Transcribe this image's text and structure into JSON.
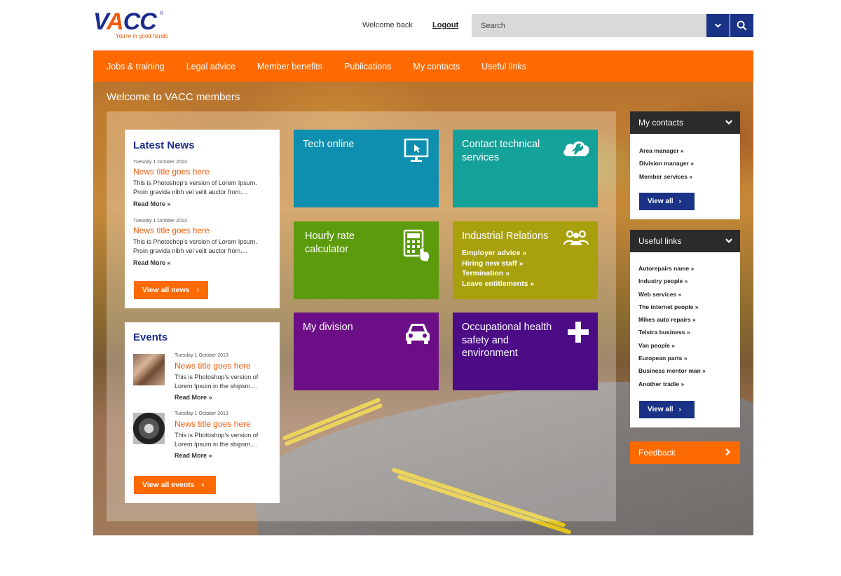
{
  "header": {
    "logo_text": "VACC",
    "logo_tagline": "You're in good hands",
    "welcome_text": "Welcome back",
    "logout_label": "Logout",
    "search_placeholder": "Search"
  },
  "nav": {
    "items": [
      "Jobs & training",
      "Legal advice",
      "Member benefits",
      "Publications",
      "My contacts",
      "Useful links"
    ]
  },
  "hero": {
    "title": "Welcome to VACC members"
  },
  "latest_news": {
    "title": "Latest News",
    "items": [
      {
        "date": "Tuesday 1 October 2013",
        "title": "News title goes here",
        "text": "This is Photoshop's version  of Lorem Ipsum. Proin gravida nibh vel velit auctor from....",
        "read_more": "Read More »"
      },
      {
        "date": "Tuesday 1 October 2013",
        "title": "News title goes here",
        "text": "This is Photoshop's version  of Lorem Ipsum. Proin gravida nibh vel velit auctor from....",
        "read_more": "Read More »"
      }
    ],
    "button_label": "View all news"
  },
  "events": {
    "title": "Events",
    "items": [
      {
        "date": "Tuesday 1 October 2013",
        "title": "News title goes here",
        "text": "This is Photoshop's version  of Lorem Ipsum in the shipsm....",
        "read_more": "Read More »"
      },
      {
        "date": "Tuesday 1 October 2013",
        "title": "News title goes here",
        "text": "This is Photoshop's version  of Lorem Ipsum in the shipsm....",
        "read_more": "Read More »"
      }
    ],
    "button_label": "View all events"
  },
  "tiles": {
    "tech_online": {
      "title": "Tech online",
      "color": "#0f8fb0",
      "icon": "monitor-icon"
    },
    "contact_technical": {
      "title": "Contact technical services",
      "color": "#14a19a",
      "icon": "cloud-wrench-icon"
    },
    "hourly_rate": {
      "title": "Hourly rate calculator",
      "color": "#5c9c0c",
      "icon": "calculator-icon"
    },
    "industrial_relations": {
      "title": "Industrial Relations",
      "color": "#a8a00c",
      "icon": "people-icon",
      "links": [
        "Employer advice  »",
        "Hiring new staff  »",
        "Termination  »",
        "Leave entitlements  »"
      ]
    },
    "my_division": {
      "title": "My division",
      "color": "#6c0f86",
      "icon": "car-icon"
    },
    "occupational": {
      "title": "Occupational health safety and environment",
      "color": "#4c0c86",
      "icon": "plus-icon"
    }
  },
  "my_contacts": {
    "title": "My contacts",
    "links": [
      "Area manager »",
      "Division manager »",
      "Member services »"
    ],
    "button_label": "View all"
  },
  "useful_links": {
    "title": "Useful links",
    "links": [
      "Autorepairs name »",
      "Industry people »",
      "Web services »",
      "The internet people »",
      "Mikes auto repairs »",
      "Telstra business »",
      "Van people »",
      "European parts »",
      "Business mentor man »",
      "Another tradie »"
    ],
    "button_label": "View all"
  },
  "feedback": {
    "label": "Feedback"
  },
  "colors": {
    "brand_orange": "#ff6a00",
    "brand_blue": "#1a3387"
  }
}
